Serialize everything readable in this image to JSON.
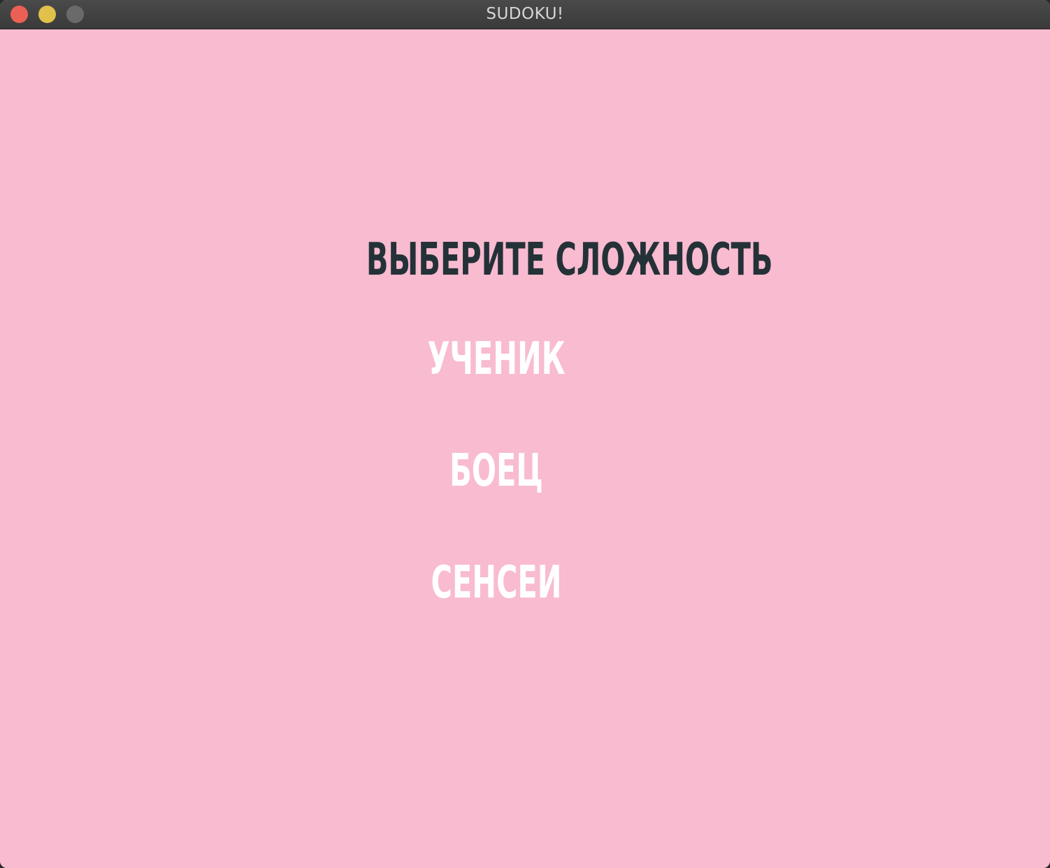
{
  "window": {
    "title": "SUDOKU!"
  },
  "menu": {
    "heading": "ВЫБЕРИТЕ СЛОЖНОСТЬ",
    "options": [
      {
        "label": "УЧЕНИК"
      },
      {
        "label": "БОЕЦ"
      },
      {
        "label": "СЕНСЕИ"
      }
    ]
  },
  "colors": {
    "background": "#f8bbd0",
    "heading": "#243238",
    "option": "#ffffff"
  }
}
